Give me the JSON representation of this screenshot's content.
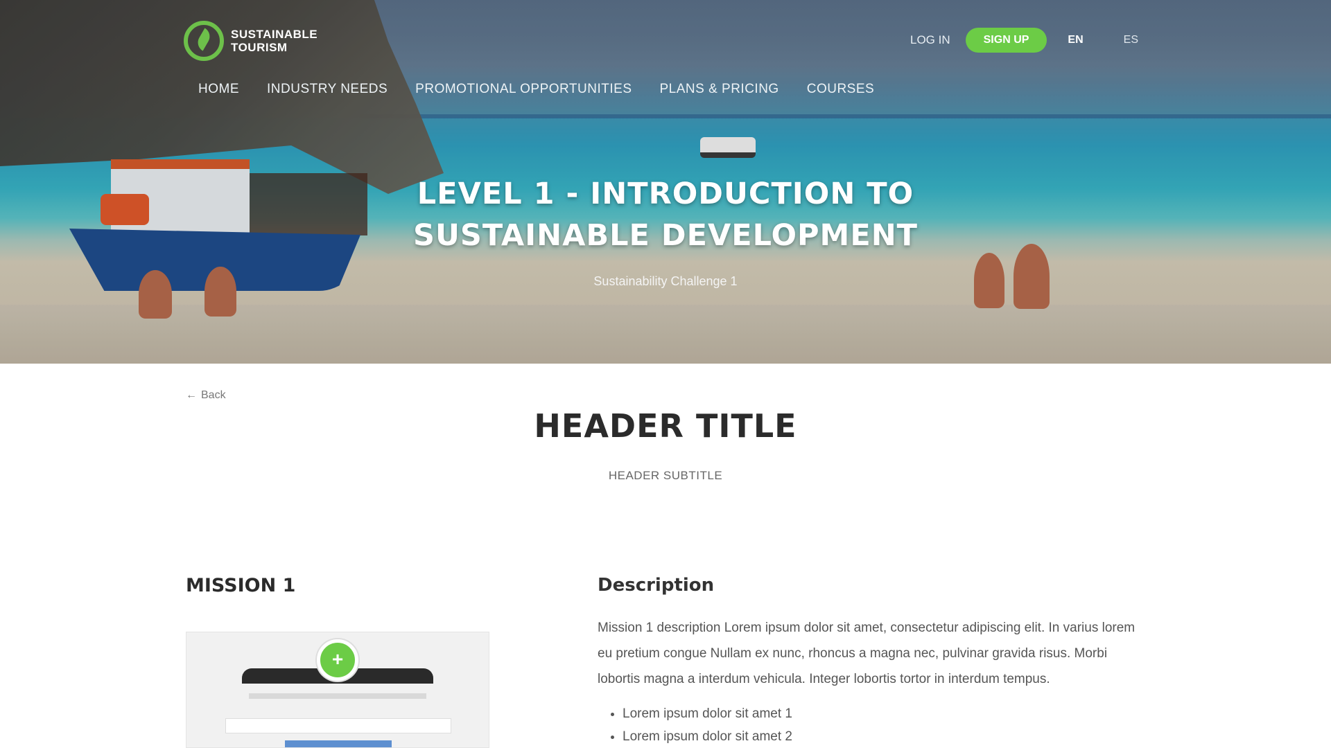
{
  "header": {
    "logo_line1": "SUSTAINABLE",
    "logo_line2": "TOURISM",
    "login_label": "LOG IN",
    "signup_label": "SIGN UP",
    "lang_active": "EN",
    "lang_other": "ES"
  },
  "nav": {
    "items": [
      {
        "label": "HOME"
      },
      {
        "label": "INDUSTRY NEEDS"
      },
      {
        "label": "PROMOTIONAL OPPORTUNITIES"
      },
      {
        "label": "PLANS & PRICING"
      },
      {
        "label": "COURSES"
      }
    ]
  },
  "hero": {
    "title_line1": "LEVEL 1 - INTRODUCTION TO",
    "title_line2": "SUSTAINABLE DEVELOPMENT",
    "subtitle": "Sustainability Challenge 1"
  },
  "content": {
    "back_label": "Back",
    "header_title": "HEADER TITLE",
    "header_subtitle": "HEADER SUBTITLE",
    "mission_title": "MISSION 1",
    "description_title": "Description",
    "description_text": "Mission 1 description Lorem ipsum dolor sit amet, consectetur adipiscing elit. In varius lorem eu pretium congue Nullam ex nunc, rhoncus a magna nec, pulvinar gravida risus. Morbi lobortis magna a interdum vehicula. Integer lobortis tortor in interdum tempus.",
    "list_items": [
      {
        "label": "Lorem ipsum dolor sit amet 1"
      },
      {
        "label": "Lorem ipsum dolor sit amet 2"
      }
    ]
  },
  "colors": {
    "accent_green": "#6ccc46",
    "heading_dark": "#2b2b2b"
  }
}
